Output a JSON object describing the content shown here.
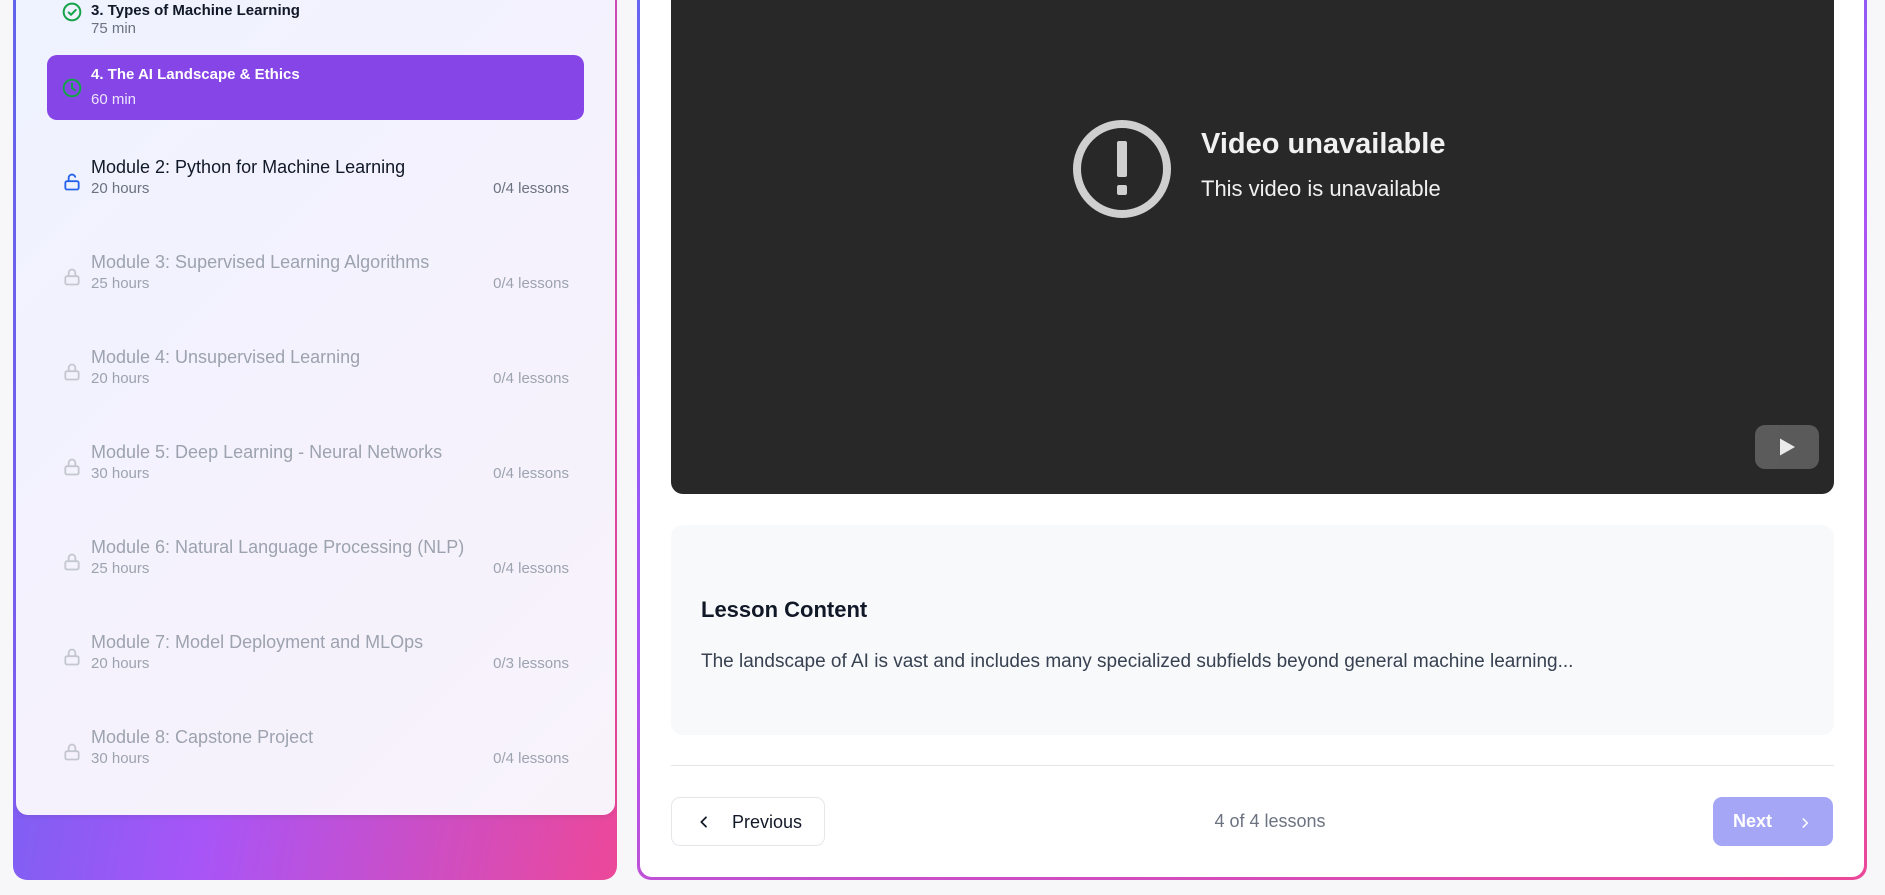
{
  "sidebar": {
    "lessons": [
      {
        "title": "3. Types of Machine Learning",
        "duration": "75 min",
        "status": "completed",
        "icon": "check-circle-icon"
      },
      {
        "title": "4. The AI Landscape & Ethics",
        "duration": "60 min",
        "status": "active",
        "icon": "clock-icon"
      }
    ],
    "modules": [
      {
        "title": "Module 2: Python for Machine Learning",
        "duration": "20 hours",
        "count": "0/4 lessons",
        "state": "unlocked",
        "icon": "unlock-icon"
      },
      {
        "title": "Module 3: Supervised Learning Algorithms",
        "duration": "25 hours",
        "count": "0/4 lessons",
        "state": "locked",
        "icon": "lock-icon"
      },
      {
        "title": "Module 4: Unsupervised Learning",
        "duration": "20 hours",
        "count": "0/4 lessons",
        "state": "locked",
        "icon": "lock-icon"
      },
      {
        "title": "Module 5: Deep Learning - Neural Networks",
        "duration": "30 hours",
        "count": "0/4 lessons",
        "state": "locked",
        "icon": "lock-icon"
      },
      {
        "title": "Module 6: Natural Language Processing (NLP)",
        "duration": "25 hours",
        "count": "0/4 lessons",
        "state": "locked",
        "icon": "lock-icon"
      },
      {
        "title": "Module 7: Model Deployment and MLOps",
        "duration": "20 hours",
        "count": "0/3 lessons",
        "state": "locked",
        "icon": "lock-icon"
      },
      {
        "title": "Module 8: Capstone Project",
        "duration": "30 hours",
        "count": "0/4 lessons",
        "state": "locked",
        "icon": "lock-icon"
      }
    ]
  },
  "video": {
    "title": "Video unavailable",
    "subtitle": "This video is unavailable",
    "icons": [
      "alert-circle-icon",
      "youtube-play-icon"
    ]
  },
  "lesson_content": {
    "heading": "Lesson Content",
    "body": "The landscape of AI is vast and includes many specialized subfields beyond general machine learning..."
  },
  "navigation": {
    "previous_label": "Previous",
    "next_label": "Next",
    "counter": "4 of 4 lessons",
    "icons": [
      "chevron-left-icon",
      "chevron-right-icon"
    ]
  },
  "colors": {
    "accent": "#8645e6",
    "gradient_start": "#6366f1",
    "gradient_mid": "#a855f7",
    "gradient_end": "#ec4899",
    "completed_green": "#16a34a",
    "unlocked_blue": "#2563eb",
    "next_button": "#a5a6f6"
  }
}
